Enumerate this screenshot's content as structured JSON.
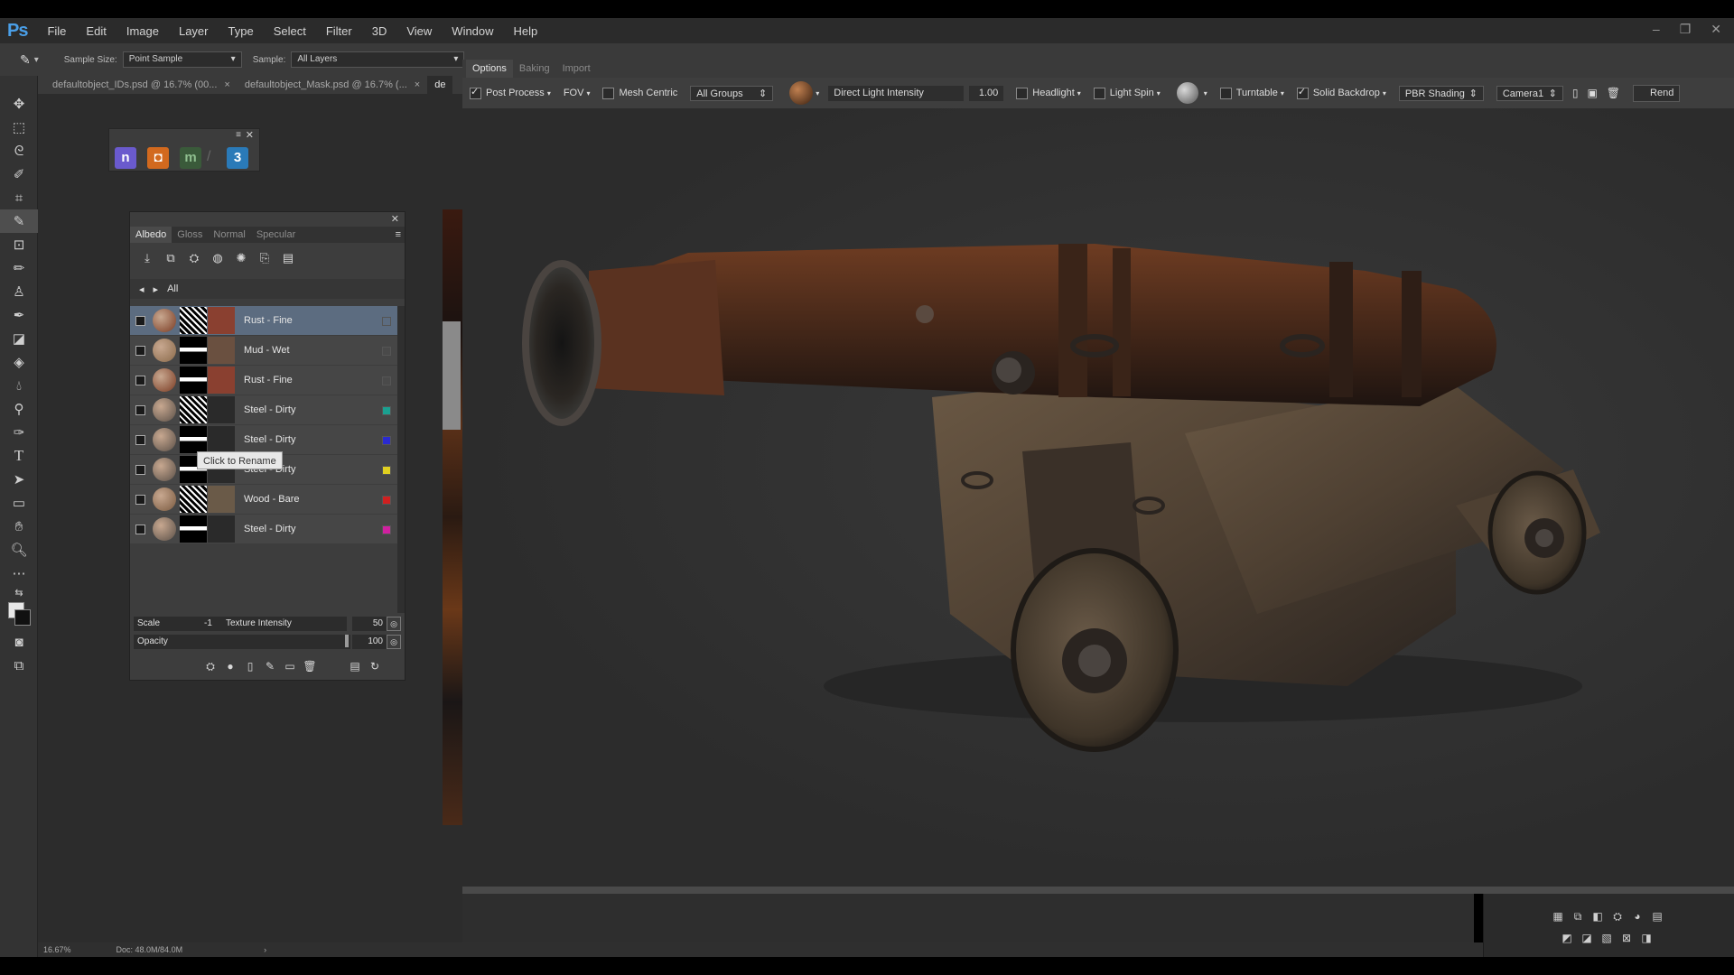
{
  "app": {
    "logo": "Ps",
    "menu": [
      "File",
      "Edit",
      "Image",
      "Layer",
      "Type",
      "Select",
      "Filter",
      "3D",
      "View",
      "Window",
      "Help"
    ]
  },
  "options_bar": {
    "sample_size_label": "Sample Size:",
    "sample_size_value": "Point Sample",
    "sample_label": "Sample:",
    "sample_value": "All Layers"
  },
  "doc_tabs": [
    {
      "label": "defaultobject_IDs.psd @ 16.7% (00...",
      "close": "×"
    },
    {
      "label": "defaultobject_Mask.psd @ 16.7% (...",
      "close": "×"
    },
    {
      "label": "de"
    }
  ],
  "launcher": {
    "apps": [
      {
        "glyph": "n",
        "color": "#6a5acd"
      },
      {
        "glyph": "◘",
        "color": "#d2691e"
      },
      {
        "glyph": "m",
        "color": "#3a5a3a"
      },
      {
        "glyph": "3",
        "color": "#2a7ab8"
      }
    ]
  },
  "layer_panel": {
    "tabs": [
      "Albedo",
      "Gloss",
      "Normal",
      "Specular"
    ],
    "active_tab": "Albedo",
    "nav_label": "All",
    "layers": [
      {
        "name": "Rust - Fine",
        "ball": "#7a3a22",
        "swatch": "#8a4030",
        "tag": "#5c6c80",
        "selected": true
      },
      {
        "name": "Mud - Wet",
        "ball": "#8a6a4a",
        "swatch": "#6a5040",
        "tag": "#4a4a4a",
        "selected": false
      },
      {
        "name": "Rust - Fine",
        "ball": "#7a3a22",
        "swatch": "#8a4030",
        "tag": "#4a4a4a",
        "selected": false
      },
      {
        "name": "Steel - Dirty",
        "ball": "#5a5048",
        "swatch": "#2a2a2a",
        "tag": "#1aa090",
        "selected": false
      },
      {
        "name": "Steel - Dirty",
        "ball": "#5a5048",
        "swatch": "#2a2a2a",
        "tag": "#2a2ad0",
        "selected": false
      },
      {
        "name": "Steel - Dirty",
        "ball": "#5a5048",
        "swatch": "#2a2a2a",
        "tag": "#e0d020",
        "selected": false
      },
      {
        "name": "Wood - Bare",
        "ball": "#7a5a40",
        "swatch": "#6a5a48",
        "tag": "#d02020",
        "selected": false
      },
      {
        "name": "Steel - Dirty",
        "ball": "#5a5048",
        "swatch": "#2a2a2a",
        "tag": "#d020a0",
        "selected": false
      }
    ],
    "scale_label": "Scale",
    "scale_value": "-1",
    "texture_intensity_label": "Texture Intensity",
    "texture_intensity_value": "50",
    "opacity_label": "Opacity",
    "opacity_value": "100"
  },
  "tooltip": "Click to Rename",
  "viewport": {
    "tabs": [
      "Options",
      "Baking",
      "Import"
    ],
    "active_tab": "Options",
    "post_process": "Post Process",
    "fov": "FOV",
    "mesh_centric": "Mesh Centric",
    "groups": "All Groups",
    "light_intensity_label": "Direct Light Intensity",
    "light_intensity_value": "1.00",
    "headlight": "Headlight",
    "light_spin": "Light Spin",
    "turntable": "Turntable",
    "solid_backdrop": "Solid Backdrop",
    "shading": "PBR Shading",
    "camera": "Camera1",
    "render": "Rend"
  },
  "status": {
    "zoom": "16.67%",
    "doc": "Doc: 48.0M/84.0M"
  }
}
